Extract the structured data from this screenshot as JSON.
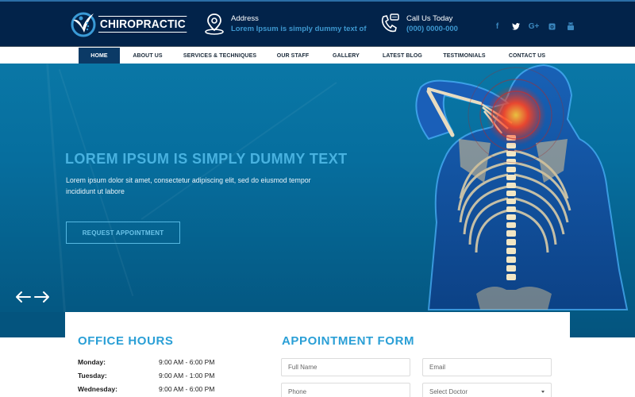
{
  "header": {
    "logo_text": "CHIROPRACTIC",
    "address": {
      "label": "Address",
      "value": "Lorem Ipsum is simply dummy text of",
      "icon": "map-pin-icon"
    },
    "phone": {
      "label": "Call Us Today",
      "value": "(000) 0000-000",
      "icon": "phone-chat-icon"
    },
    "social": [
      {
        "name": "facebook",
        "glyph": "f"
      },
      {
        "name": "twitter",
        "glyph": "t"
      },
      {
        "name": "google-plus",
        "glyph": "G+"
      },
      {
        "name": "instagram",
        "glyph": "◙"
      },
      {
        "name": "youtube",
        "glyph": "▣"
      }
    ]
  },
  "nav": {
    "items": [
      {
        "label": "HOME",
        "active": true
      },
      {
        "label": "ABOUT US"
      },
      {
        "label": "SERVICES & TECHNIQUES"
      },
      {
        "label": "OUR STAFF"
      },
      {
        "label": "GALLERY"
      },
      {
        "label": "LATEST BLOG"
      },
      {
        "label": "TESTIMONIALS"
      },
      {
        "label": "CONTACT US"
      }
    ]
  },
  "hero": {
    "title": "LOREM IPSUM IS SIMPLY DUMMY TEXT",
    "description": "Lorem ipsum dolor sit amet, consectetur adipiscing elit, sed do eiusmod tempor incididunt ut labore",
    "button_label": "REQUEST APPOINTMENT",
    "prev_arrow": "←",
    "next_arrow": "→"
  },
  "office_hours": {
    "title": "OFFICE HOURS",
    "rows": [
      {
        "day": "Monday:",
        "time": "9:00 AM - 6:00 PM"
      },
      {
        "day": "Tuesday:",
        "time": "9:00 AM - 1:00 PM"
      },
      {
        "day": "Wednesday:",
        "time": "9:00 AM - 6:00 PM"
      }
    ]
  },
  "appointment_form": {
    "title": "APPOINTMENT FORM",
    "full_name_placeholder": "Full Name",
    "email_placeholder": "Email",
    "phone_placeholder": "Phone",
    "doctor_select": "Select Doctor"
  },
  "colors": {
    "header_bg": "#02234a",
    "accent": "#2a9fd6",
    "nav_active": "#0b3a66",
    "hero_bg": "#066e9e"
  }
}
